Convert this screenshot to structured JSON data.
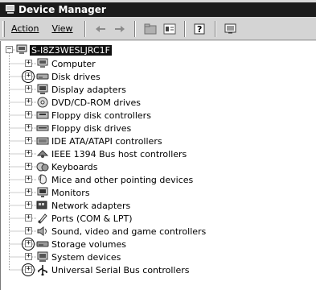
{
  "window": {
    "title": "Device Manager"
  },
  "menu": {
    "action": "Action",
    "view": "View"
  },
  "toolbar": {
    "buttons": [
      "back-arrow-icon",
      "forward-arrow-icon",
      "up-folder-icon",
      "properties-icon",
      "help-icon",
      "scan-hardware-icon"
    ]
  },
  "tree": {
    "root": "S-I8Z3WESLJRC1F",
    "items": [
      {
        "label": "Computer",
        "icon": "computer-icon",
        "circled": false
      },
      {
        "label": "Disk drives",
        "icon": "disk-drive-icon",
        "circled": true
      },
      {
        "label": "Display adapters",
        "icon": "display-adapter-icon",
        "circled": false
      },
      {
        "label": "DVD/CD-ROM drives",
        "icon": "dvd-drive-icon",
        "circled": false
      },
      {
        "label": "Floppy disk controllers",
        "icon": "floppy-controller-icon",
        "circled": false
      },
      {
        "label": "Floppy disk drives",
        "icon": "floppy-drive-icon",
        "circled": false
      },
      {
        "label": "IDE ATA/ATAPI controllers",
        "icon": "ide-controller-icon",
        "circled": false
      },
      {
        "label": "IEEE 1394 Bus host controllers",
        "icon": "ieee1394-icon",
        "circled": false
      },
      {
        "label": "Keyboards",
        "icon": "keyboard-icon",
        "circled": false
      },
      {
        "label": "Mice and other pointing devices",
        "icon": "mouse-icon",
        "circled": false
      },
      {
        "label": "Monitors",
        "icon": "monitor-icon",
        "circled": false
      },
      {
        "label": "Network adapters",
        "icon": "network-adapter-icon",
        "circled": false
      },
      {
        "label": "Ports (COM & LPT)",
        "icon": "port-icon",
        "circled": false
      },
      {
        "label": "Sound, video and game controllers",
        "icon": "sound-icon",
        "circled": false
      },
      {
        "label": "Storage volumes",
        "icon": "storage-volume-icon",
        "circled": true
      },
      {
        "label": "System devices",
        "icon": "system-device-icon",
        "circled": false
      },
      {
        "label": "Universal Serial Bus controllers",
        "icon": "usb-icon",
        "circled": true
      }
    ]
  }
}
